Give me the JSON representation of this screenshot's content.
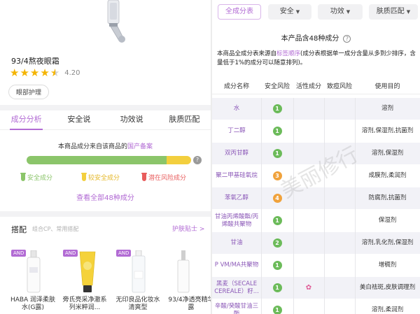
{
  "colors": {
    "accent": "#b26bd4",
    "safe": "#8bc56a",
    "medium": "#f3cf3e",
    "risk": "#e85d5d",
    "badge_green": "#6cbb5a",
    "badge_orange": "#f0a23c"
  },
  "product": {
    "name": "93/4熬夜眼霜",
    "rating": "4.20",
    "rating_value": 4.2,
    "tag": "眼部护理"
  },
  "left_tabs": [
    "成分分析",
    "安全说",
    "功效说",
    "肤质匹配"
  ],
  "source": {
    "prefix": "本商品成分来自该商品的",
    "link": "国产备案"
  },
  "safety_bar": {
    "safe_fraction": 0.85,
    "medium_fraction": 0.15
  },
  "legend": [
    "安全成分",
    "较安全成分",
    "潜在风险成分"
  ],
  "view_all": "查看全部48种成分",
  "match": {
    "title": "搭配",
    "subtitle": "组合CP、常用搭配",
    "link": "护肤贴士 >",
    "badge": "AND",
    "products": [
      {
        "name": "HABA 润泽柔肤水(G露)",
        "icon": "bottle-icon"
      },
      {
        "name": "旁氏亮采净澈系列米粹润...",
        "icon": "tube-icon"
      },
      {
        "name": "无印良品化妆水 清爽型",
        "icon": "bottle-icon"
      },
      {
        "name": "93/4净透亮精华露",
        "icon": "bottle-icon"
      }
    ]
  },
  "filters": {
    "all": "全成分表",
    "safety": "安全",
    "effect": "功效",
    "skin": "肤质匹配"
  },
  "ingredient_count": "本产品含48种成分",
  "description": {
    "pre": "本商品全成分表来源自",
    "highlight": "标签顺序",
    "post": "(成分表根据单一成分含量从多到少排序，含量低于1%的成分可以随意排列)。"
  },
  "table": {
    "headers": [
      "成分名称",
      "安全风险",
      "活性成分",
      "致痘风险",
      "使用目的"
    ],
    "rows": [
      {
        "name": "水",
        "risk": "1",
        "level": "green",
        "active": "",
        "purpose": "溶剂"
      },
      {
        "name": "丁二醇",
        "risk": "1",
        "level": "green",
        "active": "",
        "purpose": "溶剂,保湿剂,抗菌剂"
      },
      {
        "name": "双丙甘醇",
        "risk": "1",
        "level": "green",
        "active": "",
        "purpose": "溶剂,保湿剂"
      },
      {
        "name": "聚二甲基硅氧烷",
        "risk": "3",
        "level": "orange",
        "active": "",
        "purpose": "成膜剂,柔润剂"
      },
      {
        "name": "苯氧乙醇",
        "risk": "4",
        "level": "orange",
        "active": "",
        "purpose": "防腐剂,抗菌剂"
      },
      {
        "name": "甘油丙烯酸酯/丙烯酸共聚物",
        "risk": "1",
        "level": "green",
        "active": "",
        "purpose": "保湿剂"
      },
      {
        "name": "甘油",
        "risk": "2",
        "level": "green",
        "active": "",
        "purpose": "溶剂,乳化剂,保湿剂"
      },
      {
        "name": "P VM/MA共聚物",
        "risk": "1",
        "level": "green",
        "active": "",
        "purpose": "增稠剂"
      },
      {
        "name": "黑麦（SECALE CEREALE）籽...",
        "risk": "1",
        "level": "green",
        "active": "✿",
        "purpose": "美白祛斑,皮肤调理剂"
      },
      {
        "name": "辛酸/癸酸甘油三酯",
        "risk": "1",
        "level": "green",
        "active": "",
        "purpose": "溶剂,柔润剂"
      }
    ]
  },
  "watermark": "美丽修行"
}
